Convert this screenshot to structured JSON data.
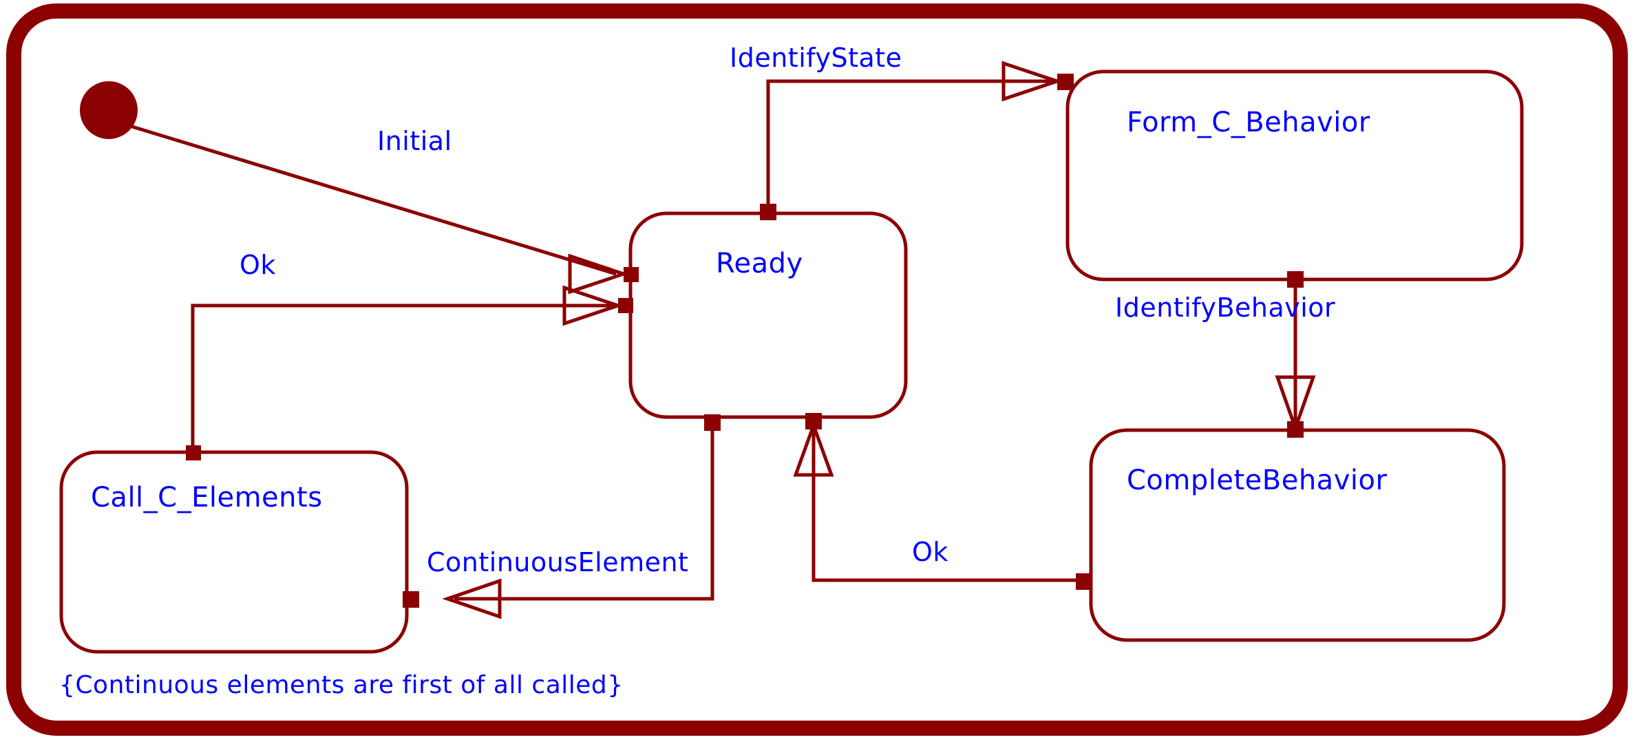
{
  "diagram": {
    "type": "uml-state-machine",
    "title": "",
    "colors": {
      "frame": "#8B0000",
      "line": "#8B0000",
      "state_border": "#8B0000",
      "text": "#0000FF",
      "background": "#FFFFFF",
      "initial_fill": "#8B0000"
    },
    "note": "{Continuous elements are first of all called}",
    "initial_pseudostate": "initial-state-marker",
    "states": [
      {
        "id": "ready",
        "label": "Ready"
      },
      {
        "id": "form_c_behavior",
        "label": "Form_C_Behavior"
      },
      {
        "id": "complete_behavior",
        "label": "CompleteBehavior"
      },
      {
        "id": "call_c_elements",
        "label": "Call_C_Elements"
      }
    ],
    "transitions": [
      {
        "id": "t-initial",
        "label": "Initial",
        "from": "initial-pseudostate",
        "to": "ready"
      },
      {
        "id": "t-ok-call",
        "label": "Ok",
        "from": "call_c_elements",
        "to": "ready"
      },
      {
        "id": "t-identify-state",
        "label": "IdentifyState",
        "from": "ready",
        "to": "form_c_behavior"
      },
      {
        "id": "t-identify-behavior",
        "label": "IdentifyBehavior",
        "from": "form_c_behavior",
        "to": "complete_behavior"
      },
      {
        "id": "t-ok-complete",
        "label": "Ok",
        "from": "complete_behavior",
        "to": "ready"
      },
      {
        "id": "t-continuous-element",
        "label": "ContinuousElement",
        "from": "ready",
        "to": "call_c_elements"
      }
    ]
  }
}
